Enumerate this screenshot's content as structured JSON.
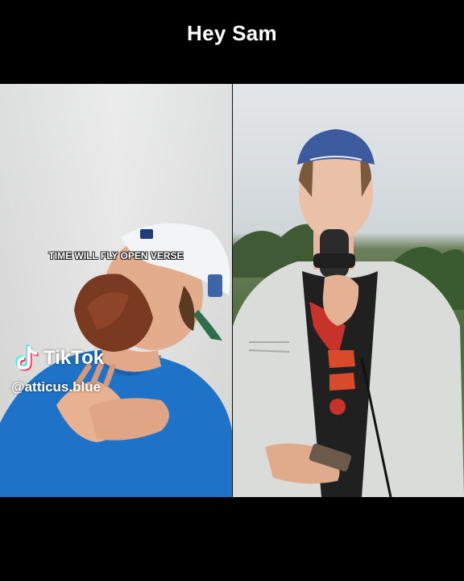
{
  "header": {
    "title": "Hey Sam"
  },
  "left_video": {
    "caption": "TIME WILL FLY OPEN VERSE",
    "watermark_brand": "TikTok",
    "watermark_handle": "@atticus.blue"
  },
  "colors": {
    "background": "#000000",
    "left_shirt": "#1e73c8",
    "right_cap": "#3c5a9e",
    "tiktok_cyan": "#25f4ee",
    "tiktok_red": "#fe2c55"
  }
}
